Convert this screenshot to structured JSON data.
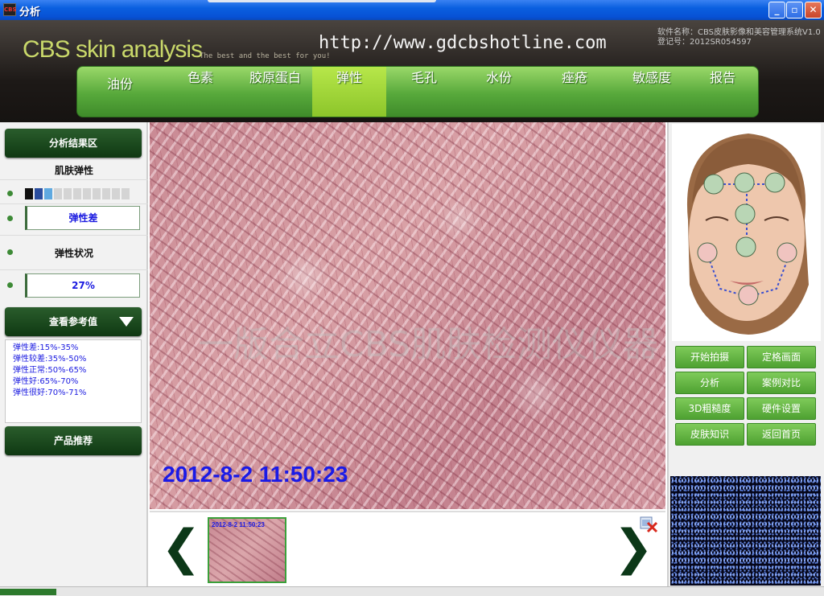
{
  "window": {
    "title": "分析",
    "app_icon_text": "CBS",
    "controls": {
      "minimize": "_",
      "maximize": "▫",
      "close": "✕"
    }
  },
  "header": {
    "logo": "CBS skin analysis",
    "slogan": "The best and the best for you!",
    "url": "http://www.gdcbshotline.com",
    "software_name": "软件名称：CBS皮肤影像和美容管理系统V1.0",
    "registration": "登记号：2012SR054597"
  },
  "nav": {
    "items": [
      "油份",
      "色素",
      "胶原蛋白",
      "弹性",
      "毛孔",
      "水份",
      "痤疮",
      "敏感度",
      "报告"
    ],
    "active": "弹性"
  },
  "left": {
    "results_title": "分析结果区",
    "skin_label": "肌肤弹性",
    "scale_level": 3,
    "scale_segments": 11,
    "elasticity_value": "弹性差",
    "status_label": "弹性状况",
    "status_value": "27%",
    "reference_title": "查看参考值",
    "reference": [
      "弹性差:15%-35%",
      "弹性较差:35%-50%",
      "弹性正常:50%-65%",
      "弹性好:65%-70%",
      "弹性很好:70%-71%"
    ],
    "product_title": "产品推荐"
  },
  "main": {
    "timestamp": "2012-8-2 11:50:23",
    "watermark": "一版合立CBS肌肤检测仪仪器",
    "thumbnail_timestamp": "2012-8-2 11:50:23",
    "prev_arrow": "❮",
    "next_arrow": "❯"
  },
  "right": {
    "buttons": [
      "开始拍摄",
      "定格画面",
      "分析",
      "案例对比",
      "3D粗糙度",
      "硬件设置",
      "皮肤知识",
      "返回首页"
    ]
  },
  "colors": {
    "nav_green": "#57a93b",
    "nav_active": "#8cc52a",
    "panel_green_dark": "#0f3812",
    "value_text": "#1a1ae0",
    "face_point_green": "#b9d6b5",
    "face_point_pink": "#f0c4c0"
  }
}
